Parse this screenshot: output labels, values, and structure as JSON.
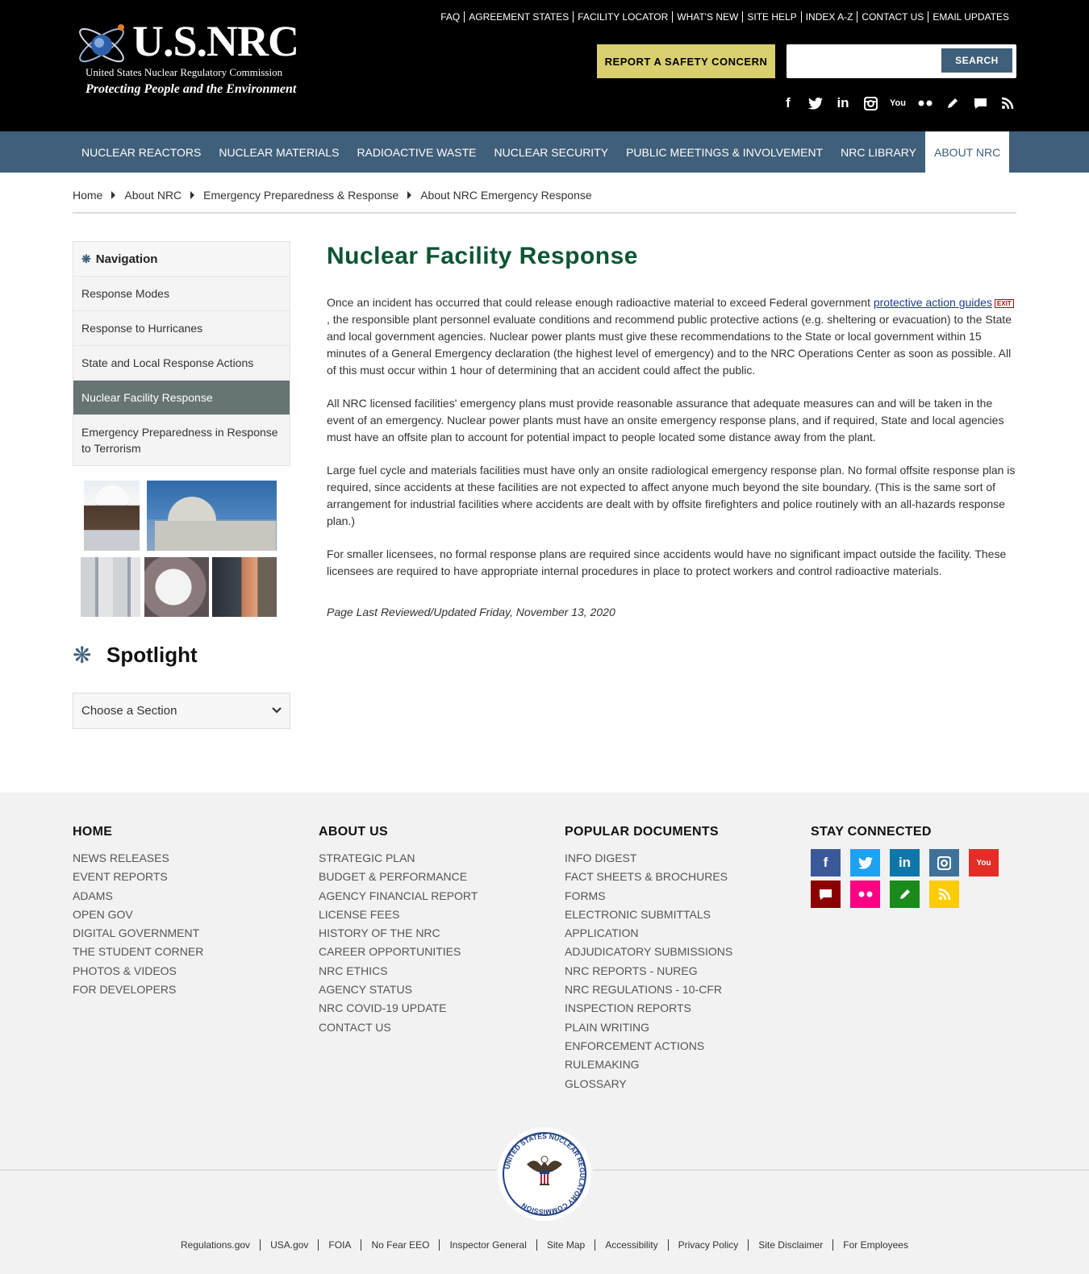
{
  "header": {
    "logo_text": "U.S.NRC",
    "logo_subtitle": "United States Nuclear Regulatory Commission",
    "logo_tagline": "Protecting People and the Environment",
    "utility_links": [
      "FAQ",
      "AGREEMENT STATES",
      "FACILITY LOCATOR",
      "WHAT'S NEW",
      "SITE HELP",
      "INDEX A-Z",
      "CONTACT US",
      "EMAIL UPDATES"
    ],
    "report_button": "REPORT A SAFETY CONCERN",
    "search": {
      "value": "",
      "placeholder": "",
      "button": "SEARCH"
    },
    "social_icons": [
      "facebook-icon",
      "twitter-icon",
      "linkedin-icon",
      "instagram-icon",
      "youtube-icon",
      "flickr-icon",
      "blog-icon",
      "comment-icon",
      "rss-icon"
    ]
  },
  "main_nav": {
    "items": [
      "NUCLEAR REACTORS",
      "NUCLEAR MATERIALS",
      "RADIOACTIVE WASTE",
      "NUCLEAR SECURITY",
      "PUBLIC MEETINGS & INVOLVEMENT",
      "NRC LIBRARY",
      "ABOUT NRC"
    ],
    "active": "ABOUT NRC"
  },
  "breadcrumb": [
    "Home",
    "About NRC",
    "Emergency Preparedness & Response",
    "About NRC Emergency Response"
  ],
  "sidebar": {
    "title": "Navigation",
    "items": [
      "Response Modes",
      "Response to Hurricanes",
      "State and Local Response Actions",
      "Nuclear Facility Response",
      "Emergency Preparedness in Response to Terrorism"
    ],
    "active": "Nuclear Facility Response",
    "spotlight_title": "Spotlight",
    "choose_section": "Choose a Section"
  },
  "content": {
    "title": "Nuclear Facility Response",
    "p1_before": "Once an incident has occurred that could release enough radioactive material to exceed Federal government ",
    "p1_link": "protective action guides",
    "p1_exit": "EXIT",
    "p1_after": ", the responsible plant personnel evaluate conditions and recommend public protective actions (e.g. sheltering or evacuation) to the State and local government agencies. Nuclear power plants must give these recommendations to the State or local government within 15 minutes of a General Emergency declaration (the highest level of emergency) and to the NRC Operations Center as soon as possible. All of this must occur within 1 hour of determining that an accident could affect the public.",
    "p2": "All NRC licensed facilities' emergency plans must provide reasonable assurance that adequate measures can and will be taken in the event of an emergency. Nuclear power plants must have an onsite emergency response plans, and if required, State and local agencies must have an offsite plan to account for potential impact to people located some distance away from the plant.",
    "p3": "Large fuel cycle and materials facilities must have only an onsite radiological emergency response plan. No formal offsite response plan is required, since accidents at these facilities are not expected to affect anyone much beyond the site boundary. (This is the same sort of arrangement for industrial facilities where accidents are dealt with by offsite firefighters and police routinely with an all-hazards response plan.)",
    "p4": "For smaller licensees, no formal response plans are required since accidents would have no significant impact outside the facility. These licensees are required to have appropriate internal procedures in place to protect workers and control radioactive materials.",
    "reviewed": "Page Last Reviewed/Updated Friday, November 13, 2020"
  },
  "footer": {
    "col1": {
      "title": "HOME",
      "links": [
        "NEWS RELEASES",
        "EVENT REPORTS",
        "ADAMS",
        "OPEN GOV",
        "DIGITAL GOVERNMENT",
        "THE STUDENT CORNER",
        "PHOTOS & VIDEOS",
        "FOR DEVELOPERS"
      ]
    },
    "col2": {
      "title": "ABOUT US",
      "links": [
        "STRATEGIC PLAN",
        "BUDGET & PERFORMANCE",
        "AGENCY FINANCIAL REPORT",
        "LICENSE FEES",
        "HISTORY OF THE NRC",
        "CAREER OPPORTUNITIES",
        "NRC ETHICS",
        "AGENCY STATUS",
        "NRC COVID-19 UPDATE",
        "CONTACT US"
      ]
    },
    "col3": {
      "title": "POPULAR DOCUMENTS",
      "links": [
        "INFO DIGEST",
        "FACT SHEETS & BROCHURES",
        "FORMS",
        "ELECTRONIC SUBMITTALS APPLICATION",
        "ADJUDICATORY SUBMISSIONS",
        "NRC REPORTS - NUREG",
        "NRC REGULATIONS - 10-CFR",
        "INSPECTION REPORTS",
        "PLAIN WRITING",
        "ENFORCEMENT ACTIONS",
        "RULEMAKING",
        "GLOSSARY"
      ]
    },
    "col4": {
      "title": "STAY CONNECTED"
    },
    "social_colors": {
      "facebook": "#3b5998",
      "twitter": "#1da1f2",
      "linkedin": "#0e76a8",
      "instagram": "#3f729b",
      "youtube": "#e52d27",
      "comment": "#8b0000",
      "flickr": "#ff0084",
      "blog": "#1a8a1a",
      "rss": "#ffcc00"
    },
    "seal_text": "UNITED STATES NUCLEAR REGULATORY COMMISSION",
    "bottom_links": [
      "Regulations.gov",
      "USA.gov",
      "FOIA",
      "No Fear EEO",
      "Inspector General",
      "Site Map",
      "Accessibility",
      "Privacy Policy",
      "Site Disclaimer",
      "For Employees"
    ]
  }
}
